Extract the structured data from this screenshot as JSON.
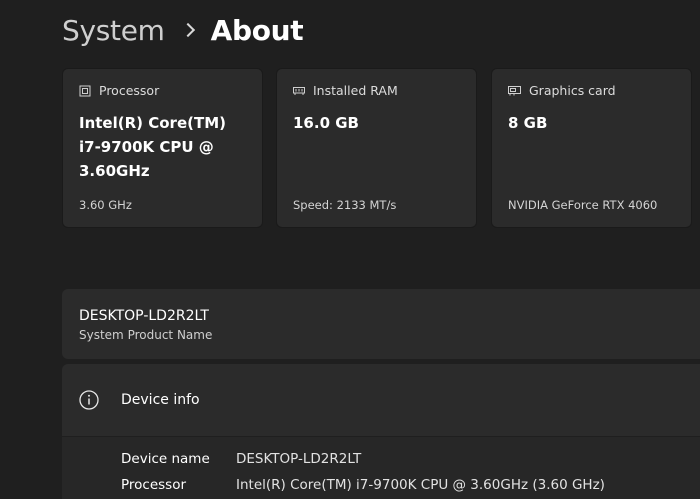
{
  "breadcrumb": {
    "parent": "System",
    "current": "About"
  },
  "cards": [
    {
      "icon": "processor-icon",
      "title": "Processor",
      "value": "Intel(R) Core(TM) i7-9700K CPU @ 3.60GHz",
      "sub": "3.60 GHz"
    },
    {
      "icon": "ram-icon",
      "title": "Installed RAM",
      "value": "16.0 GB",
      "sub": "Speed: 2133 MT/s"
    },
    {
      "icon": "graphics-card-icon",
      "title": "Graphics card",
      "value": "8 GB",
      "sub": "NVIDIA GeForce RTX 4060"
    }
  ],
  "device_name_panel": {
    "name": "DESKTOP-LD2R2LT",
    "subtitle": "System Product Name"
  },
  "device_info": {
    "title": "Device info",
    "rows": [
      {
        "label": "Device name",
        "value": "DESKTOP-LD2R2LT"
      },
      {
        "label": "Processor",
        "value": "Intel(R) Core(TM) i7-9700K CPU @ 3.60GHz (3.60 GHz)"
      }
    ]
  },
  "colors": {
    "background": "#1f1f1f",
    "card": "#2b2b2b",
    "text": "#ffffff",
    "secondary_text": "#cfcfcf"
  }
}
